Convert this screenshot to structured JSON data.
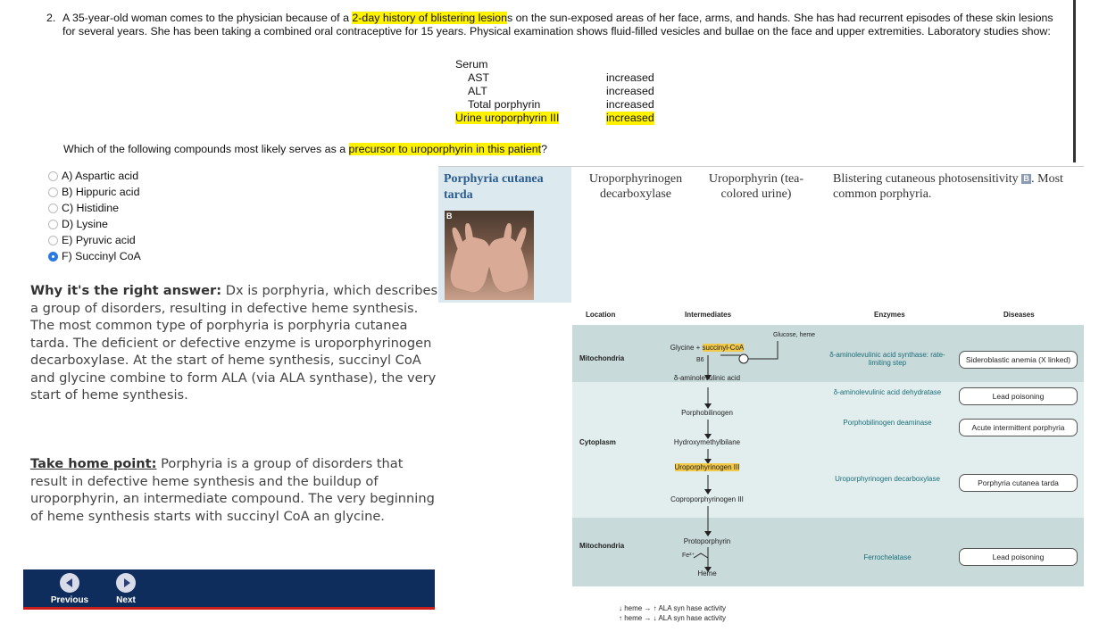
{
  "question": {
    "number": "2.",
    "intro": "A 35-year-old woman comes to the physician because of a ",
    "hl1": "2-day history of blistering lesion",
    "rest": "s on the sun-exposed areas of her face, arms, and hands. She has had recurrent episodes of these skin lesions for several years. She has been taking a combined oral contraceptive for 15 years. Physical examination shows fluid-filled vesicles and bullae on the face and upper extremities. Laboratory studies show:"
  },
  "labs": {
    "serum": "Serum",
    "rows": [
      {
        "name": "AST",
        "value": "increased"
      },
      {
        "name": "ALT",
        "value": "increased"
      },
      {
        "name": "Total porphyrin",
        "value": "increased"
      },
      {
        "name": "Urine uroporphyrin III",
        "value": "increased"
      }
    ]
  },
  "which": {
    "pre": "Which of the following compounds most likely serves as a ",
    "hl": "precursor to uroporphyrin in this patient",
    "post": "?"
  },
  "options": [
    {
      "label": "A) Aspartic acid",
      "selected": false
    },
    {
      "label": "B) Hippuric acid",
      "selected": false
    },
    {
      "label": "C) Histidine",
      "selected": false
    },
    {
      "label": "D) Lysine",
      "selected": false
    },
    {
      "label": "E) Pyruvic acid",
      "selected": false
    },
    {
      "label": "F) Succinyl CoA",
      "selected": true
    }
  ],
  "explanation": {
    "why_heading": "Why it's the right answer:",
    "why_text": " Dx is porphyria, which describes a group of disorders, resulting in defective heme synthesis. The most common type of porphyria is porphyria cutanea tarda. The deficient or defective enzyme is uroporphyrinogen decarboxylase. At the start of heme synthesis, succinyl CoA and glycine combine to form ALA (via ALA synthase), the very start of heme synthesis.",
    "home_heading": "Take home point:",
    "home_text": " Porphyria is a group of disorders that result in defective heme synthesis and the buildup of uroporphyrin, an intermediate compound. The very beginning of heme synthesis starts with succinyl CoA an glycine."
  },
  "nav": {
    "previous": "Previous",
    "next": "Next"
  },
  "porphyria_table": {
    "title": "Porphyria cutanea tarda",
    "photo_label": "B",
    "enzyme": "Uroporphyrinogen decarboxylase",
    "substrate": "Uroporphyrin (tea-colored urine)",
    "desc_pre": "Blistering cutaneous photosensitivity ",
    "desc_badge": "B",
    "desc_post": ". Most common porphyria."
  },
  "diagram": {
    "headers": {
      "location": "Location",
      "intermediates": "Intermediates",
      "enzymes": "Enzymes",
      "diseases": "Diseases"
    },
    "locations": {
      "mito1": "Mitochondria",
      "cyto": "Cytoplasm",
      "mito2": "Mitochondria"
    },
    "glucose_heme": "Glucose, heme",
    "glycine": "Glycine + ",
    "succinyl": "succinyl-CoA",
    "b6": "B6",
    "intermediates": {
      "ala": "δ-aminolevulinic acid",
      "pbg": "Porphobilinogen",
      "hmb": "Hydroxymethylbilane",
      "uro": "Uroporphyrinogen III",
      "copro": "Coproporphyrinogen III",
      "proto": "Protoporphyrin",
      "fe": "Fe²⁺",
      "heme": "Heme"
    },
    "enzymes": {
      "alas": "δ-aminolevulinic acid synthase: rate-limiting step",
      "alad": "δ-aminolevulinic acid dehydratase",
      "pbgd": "Porphobilinogen deaminase",
      "urod": "Uroporphyrinogen decarboxylase",
      "fech": "Ferrochelatase"
    },
    "diseases": {
      "sideroblastic": "Sideroblastic anemia (X linked)",
      "lead1": "Lead poisoning",
      "aip": "Acute intermittent porphyria",
      "pct": "Porphyria cutanea tarda",
      "lead2": "Lead poisoning"
    },
    "footnote1": "↓ heme → ↑ ALA syn hase activity",
    "footnote2": "↑ heme → ↓ ALA syn hase activity"
  }
}
